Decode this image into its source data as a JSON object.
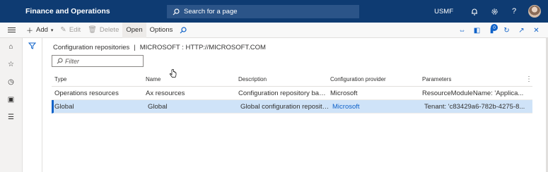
{
  "app": {
    "title": "Finance and Operations",
    "company": "USMF"
  },
  "search": {
    "placeholder": "Search for a page"
  },
  "actions": {
    "add": "Add",
    "edit": "Edit",
    "delete": "Delete",
    "open": "Open",
    "options": "Options"
  },
  "page": {
    "breadcrumb_title": "Configuration repositories",
    "breadcrumb_context": "MICROSOFT : HTTP://MICROSOFT.COM",
    "filter_placeholder": "Filter"
  },
  "grid": {
    "columns": [
      "Type",
      "Name",
      "Description",
      "Configuration provider",
      "Parameters"
    ],
    "rows": [
      {
        "type": "Operations resources",
        "name": "Ax resources",
        "description": "Configuration repository based ...",
        "provider": "Microsoft",
        "parameters": "ResourceModuleName: 'Applica...",
        "selected": false
      },
      {
        "type": "Global",
        "name": "Global",
        "description": "Global configuration repository",
        "provider": "Microsoft",
        "parameters": "Tenant: 'c83429a6-782b-4275-8...",
        "selected": true
      }
    ]
  },
  "notifications_count": "0",
  "colors": {
    "topbar": "#0e3b72",
    "accent": "#0f62c9",
    "selected_row": "#cfe3f8"
  },
  "icons": [
    "waffle-icon",
    "search-icon",
    "bell-icon",
    "gear-icon",
    "help-icon",
    "avatar",
    "hamburger-icon",
    "add-icon",
    "edit-icon",
    "delete-icon",
    "search-icon",
    "filter-icon",
    "home-icon",
    "star-icon",
    "clock-icon",
    "workspace-icon",
    "list-icon"
  ]
}
